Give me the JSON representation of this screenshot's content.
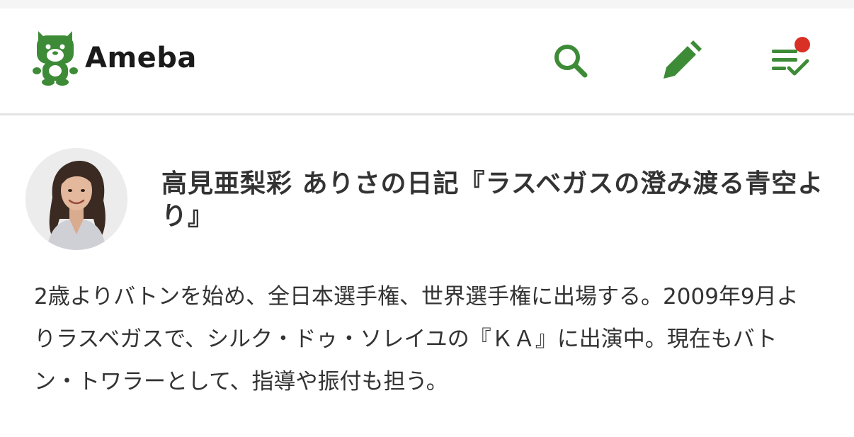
{
  "header": {
    "logo_text": "Ameba",
    "search_icon": "search-icon",
    "write_icon": "pencil-icon",
    "check_icon": "checklist-icon",
    "accent_color": "#3d8b37",
    "notification_color": "#d93025"
  },
  "profile": {
    "avatar_alt": "高見亜梨彩",
    "blog_title": "高見亜梨彩 ありさの日記『ラスベガスの澄み渡る青空より』",
    "description": "2歳よりバトンを始め、全日本選手権、世界選手権に出場する。2009年9月よりラスベガスで、シルク・ドゥ・ソレイユの『ＫＡ』に出演中。現在もバトン・トワラーとして、指導や振付も担う。"
  }
}
